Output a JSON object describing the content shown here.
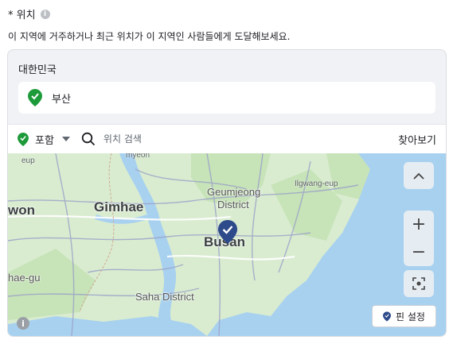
{
  "location": {
    "title": "* 위치",
    "description": "이 지역에 거주하거나 최근 위치가 이 지역인 사람들에게 도달해보세요.",
    "country": "대한민국",
    "selected_location": "부산"
  },
  "toolbar": {
    "include_label": "포함",
    "search_placeholder": "위치 검색",
    "browse_label": "찾아보기"
  },
  "map": {
    "labels": {
      "gimhae": "Gimhae",
      "busan": "Busan",
      "geumjeong": "Geumjeong",
      "district1": "District",
      "saha": "Saha District",
      "ilgwang": "Ilgwang-eup",
      "myeon": "myeon",
      "eup": "eup",
      "won": "won",
      "haegu": "hae-gu"
    },
    "controls": {
      "collapse_icon": "chevron-up-icon",
      "zoom_in": "+",
      "zoom_out": "−",
      "locate_icon": "target-icon",
      "pin_set_label": "핀 설정"
    }
  },
  "colors": {
    "accent_green": "#1d9a3a",
    "pin_navy": "#2d4a8a",
    "sea": "#a8d1f0",
    "land": "#d9ecd0"
  }
}
